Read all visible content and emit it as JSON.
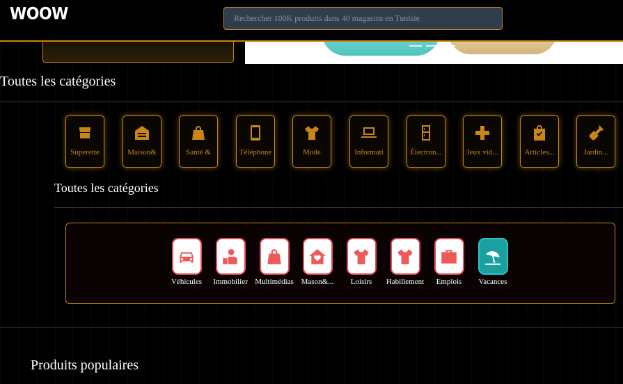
{
  "header": {
    "logo": "WOOW",
    "search_placeholder": "Rechercher 100K produits dans 40 magasins en Tunisie"
  },
  "sections": {
    "all_categories": "Toutes les catégories",
    "all_categories_2": "Toutes les catégories",
    "popular_products": "Produits populaires"
  },
  "categories": [
    {
      "label": "Superette",
      "icon": "store-icon"
    },
    {
      "label": "Maison&",
      "icon": "house-icon"
    },
    {
      "label": "Santé &",
      "icon": "bag-icon"
    },
    {
      "label": "Téléphone",
      "icon": "phone-icon"
    },
    {
      "label": "Mode",
      "icon": "tshirt-icon"
    },
    {
      "label": "Informati",
      "icon": "laptop-icon"
    },
    {
      "label": "Électron...",
      "icon": "fridge-icon"
    },
    {
      "label": "Jeux vid...",
      "icon": "gamepad-icon"
    },
    {
      "label": "Articles...",
      "icon": "shopping-bag-icon"
    },
    {
      "label": "Jardin...",
      "icon": "shovel-icon"
    }
  ],
  "subcategories": [
    {
      "label": "Véhicules",
      "icon": "car-icon"
    },
    {
      "label": "Immobilier",
      "icon": "agent-icon"
    },
    {
      "label": "Multimédias",
      "icon": "bag-icon"
    },
    {
      "label": "Mason&...",
      "icon": "home-heart-icon"
    },
    {
      "label": "Loisirs",
      "icon": "tshirt-icon"
    },
    {
      "label": "Habillement",
      "icon": "tshirt-icon"
    },
    {
      "label": "Emplois",
      "icon": "briefcase-icon"
    },
    {
      "label": "Vacances",
      "icon": "beach-icon"
    }
  ],
  "colors": {
    "accent": "#c8861a",
    "sub_icon": "#ee5a5a",
    "teal": "#1aa0a0"
  }
}
